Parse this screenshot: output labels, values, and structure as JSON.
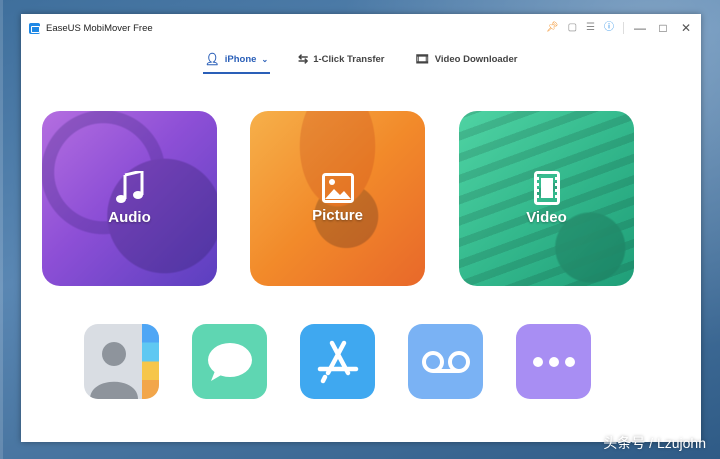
{
  "window": {
    "title": "EaseUS MobiMover Free",
    "titlebar_icons": [
      "pin-icon",
      "feedback-icon",
      "menu-icon",
      "info-icon"
    ]
  },
  "nav": {
    "tabs": [
      {
        "label": "iPhone",
        "icon": "person-icon",
        "active": true,
        "has_dropdown": true
      },
      {
        "label": "1-Click Transfer",
        "icon": "transfer-icon",
        "active": false
      },
      {
        "label": "Video Downloader",
        "icon": "film-icon",
        "active": false
      }
    ]
  },
  "cards": [
    {
      "label": "Audio",
      "icon": "music-note-icon",
      "color": "#8d4fd6"
    },
    {
      "label": "Picture",
      "icon": "image-icon",
      "color": "#f28a2a"
    },
    {
      "label": "Video",
      "icon": "film-icon",
      "color": "#34b98d"
    }
  ],
  "apps": [
    {
      "name": "contacts",
      "icon": "contacts-icon",
      "color": "#d9dde3"
    },
    {
      "name": "messages",
      "icon": "message-bubble-icon",
      "color": "#5fd6b2"
    },
    {
      "name": "app-store",
      "icon": "app-store-icon",
      "color": "#3fa8f0"
    },
    {
      "name": "voicemail",
      "icon": "voicemail-icon",
      "color": "#7ab2f4"
    },
    {
      "name": "more",
      "icon": "more-dots-icon",
      "color": "#a88ef3"
    }
  ],
  "watermark": "头条号 / Lzujohn",
  "colors": {
    "accent": "#2a5fb8",
    "pin": "#f28b1e"
  }
}
